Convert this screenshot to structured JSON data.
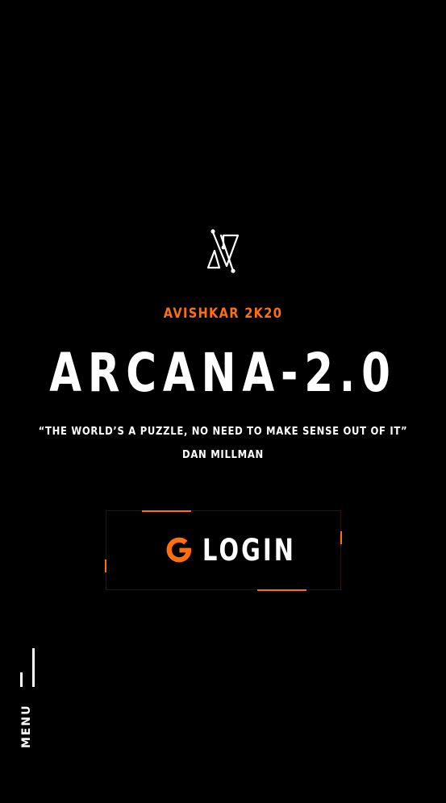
{
  "brand": {
    "logo_icon": "arcana-triangle-logo-icon",
    "subtitle": "AVISHKAR 2K20",
    "title": "ARCANA-2.0"
  },
  "quote": {
    "text": "“THE WORLD’S A PUZZLE, NO NEED TO MAKE SENSE OUT OF IT”",
    "author": "DAN MILLMAN"
  },
  "login": {
    "icon": "google-g-icon",
    "label": "LOGIN"
  },
  "menu": {
    "icon": "menu-bars-icon",
    "label": "MENU"
  },
  "colors": {
    "background": "#000000",
    "accent": "#ff6f0f",
    "text": "#ffffff"
  }
}
